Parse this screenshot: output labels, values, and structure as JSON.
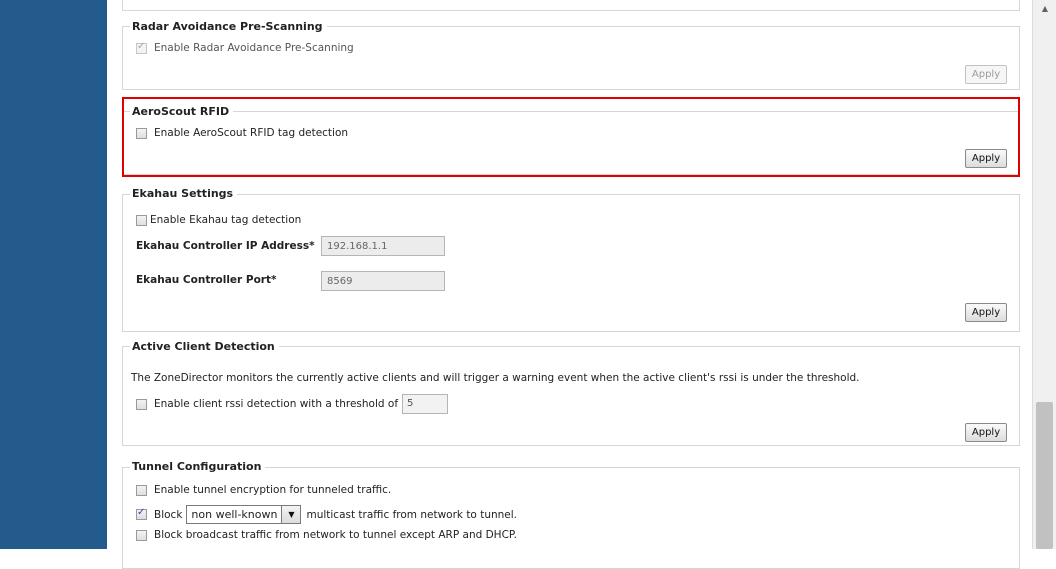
{
  "radar": {
    "legend": "Radar Avoidance Pre-Scanning",
    "checkbox_label": "Enable Radar Avoidance Pre-Scanning",
    "checked": true,
    "apply": "Apply"
  },
  "aeroscout": {
    "legend": "AeroScout RFID",
    "checkbox_label": "Enable AeroScout RFID tag detection",
    "checked": false,
    "apply": "Apply"
  },
  "ekahau": {
    "legend": "Ekahau Settings",
    "checkbox_label": "Enable Ekahau tag detection",
    "checked": false,
    "ip_label": "Ekahau Controller IP Address*",
    "ip_value": "192.168.1.1",
    "port_label": "Ekahau Controller Port*",
    "port_value": "8569",
    "apply": "Apply"
  },
  "active_client": {
    "legend": "Active Client Detection",
    "description": "The ZoneDirector monitors the currently active clients and will trigger a warning event when the active client's rssi is under the threshold.",
    "checkbox_label": "Enable client rssi detection with a threshold of",
    "threshold": "5",
    "checked": false,
    "apply": "Apply"
  },
  "tunnel": {
    "legend": "Tunnel Configuration",
    "encryption_label": "Enable tunnel encryption for tunneled traffic.",
    "block_label": "Block",
    "block_select": "non well-known",
    "block_suffix": "multicast traffic from network to tunnel.",
    "broadcast_label": "Block broadcast traffic from network to tunnel except ARP and DHCP."
  },
  "colors": {
    "sidebar": "#235b8d",
    "highlight": "#e00000"
  }
}
